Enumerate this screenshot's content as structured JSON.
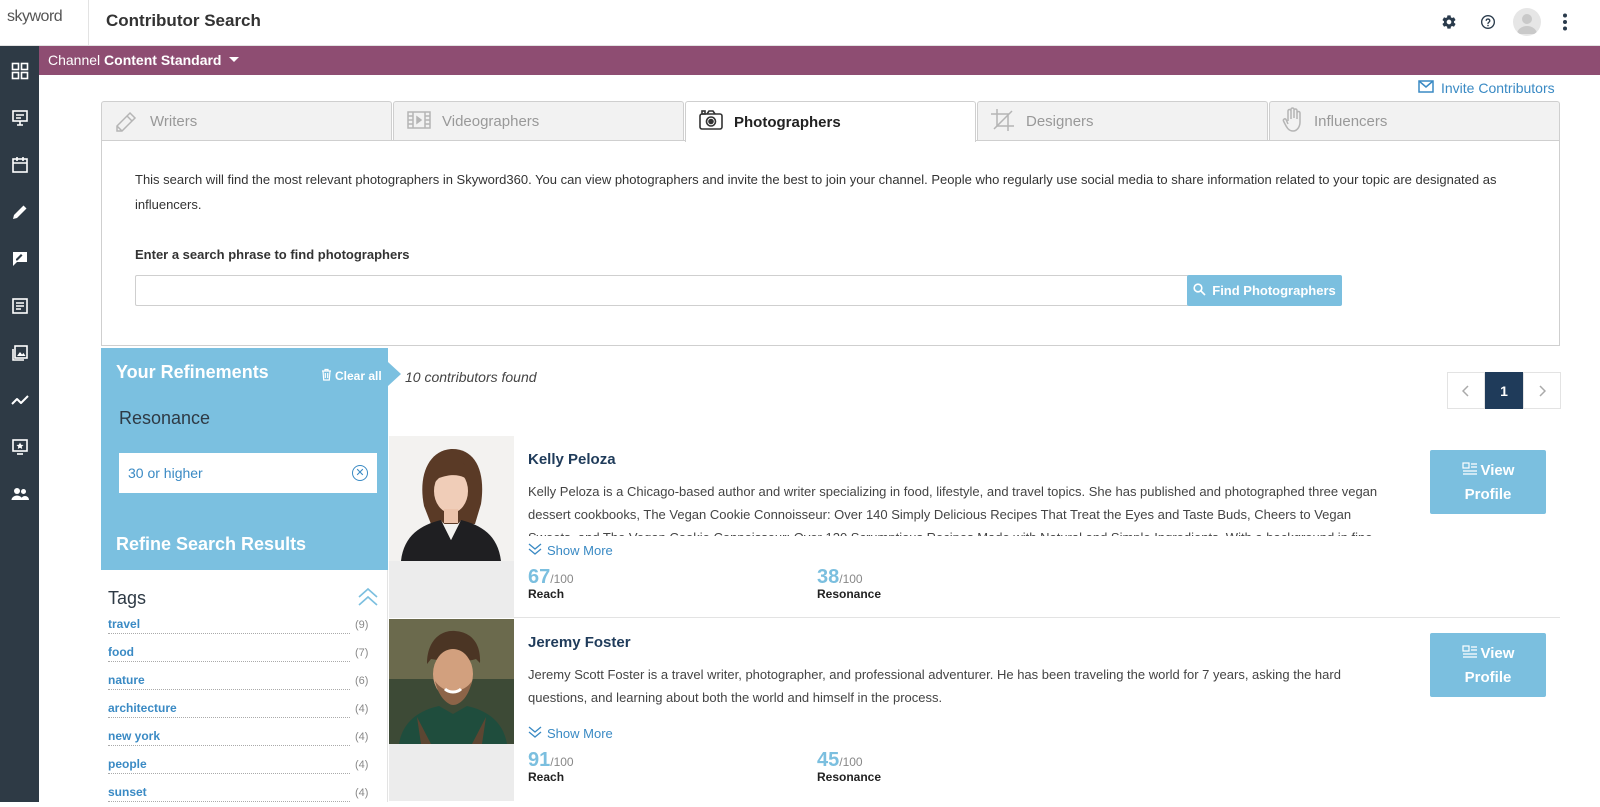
{
  "header": {
    "logo_text": "skyword",
    "title": "Contributor Search",
    "icons": [
      "gear-icon",
      "help-icon",
      "avatar",
      "more-vert-icon"
    ]
  },
  "sidebar": {
    "icons": [
      "dashboard-icon",
      "presentation-icon",
      "calendar-icon",
      "pencil-icon",
      "comment-edit-icon",
      "article-icon",
      "gallery-icon",
      "analytics-icon",
      "star-screen-icon",
      "people-icon"
    ]
  },
  "channel": {
    "label": "Channel",
    "name": "Content Standard"
  },
  "invite_label": "Invite Contributors",
  "tabs": [
    {
      "label": "Writers",
      "icon": "pen-icon",
      "active": false
    },
    {
      "label": "Videographers",
      "icon": "film-icon",
      "active": false
    },
    {
      "label": "Photographers",
      "icon": "camera-icon",
      "active": true
    },
    {
      "label": "Designers",
      "icon": "crop-icon",
      "active": false
    },
    {
      "label": "Influencers",
      "icon": "hand-icon",
      "active": false
    }
  ],
  "search": {
    "description": "This search will find the most relevant photographers in Skyword360. You can view photographers and invite the best to join your channel. People who regularly use social media to share information related to your topic are designated as influencers.",
    "label": "Enter a search phrase to find photographers",
    "value": "",
    "placeholder": "",
    "button_label": "Find Photographers"
  },
  "refinements": {
    "title": "Your Refinements",
    "clear_label": "Clear all",
    "facet": "Resonance",
    "chip": "30 or higher",
    "refine_title": "Refine Search Results"
  },
  "tags": {
    "title": "Tags",
    "items": [
      {
        "name": "travel",
        "count": "(9)"
      },
      {
        "name": "food",
        "count": "(7)"
      },
      {
        "name": "nature",
        "count": "(6)"
      },
      {
        "name": "architecture",
        "count": "(4)"
      },
      {
        "name": "new york",
        "count": "(4)"
      },
      {
        "name": "people",
        "count": "(4)"
      },
      {
        "name": "sunset",
        "count": "(4)"
      }
    ]
  },
  "results": {
    "count_text": "10 contributors found",
    "page": "1",
    "show_more_label": "Show More",
    "view_profile_line1": "View",
    "view_profile_line2": "Profile",
    "reach_label": "Reach",
    "resonance_label": "Resonance",
    "denominator": "/100",
    "contributors": [
      {
        "name": "Kelly Peloza",
        "bio": "Kelly Peloza is a Chicago-based author and writer specializing in food, lifestyle, and travel topics. She has published and photographed three vegan dessert cookbooks, The Vegan Cookie Connoisseur: Over 140 Simply Delicious Recipes That Treat the Eyes and Taste Buds, Cheers to Vegan Sweets, and The Vegan Cookie Connoisseur: Over 120 Scrumptious Recipes Made with Natural and Simple Ingredients. With a background in fine arts and a",
        "reach": "67",
        "resonance": "38"
      },
      {
        "name": "Jeremy Foster",
        "bio": "Jeremy Scott Foster is a travel writer, photographer, and professional adventurer. He has been traveling the world for 7 years, asking the hard questions, and learning about both the world and himself in the process.",
        "reach": "91",
        "resonance": "45"
      }
    ]
  }
}
